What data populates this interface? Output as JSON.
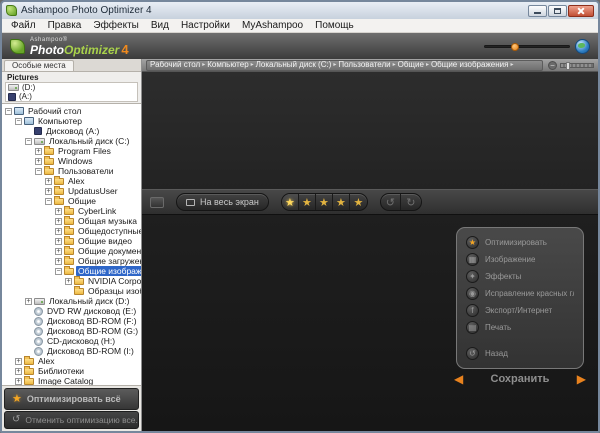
{
  "window": {
    "title": "Ashampoo Photo Optimizer 4"
  },
  "menubar": {
    "items": [
      "Файл",
      "Правка",
      "Эффекты",
      "Вид",
      "Настройки",
      "MyAshampoo",
      "Помощь"
    ]
  },
  "logo": {
    "brand_prefix": "Ashampoo®",
    "brand_white": "Photo",
    "brand_green": "Optimizer",
    "version": "4"
  },
  "breadcrumb": {
    "items": [
      "Рабочий стол",
      "Компьютер",
      "Локальный диск (C:)",
      "Пользователи",
      "Общие",
      "Общие изображения"
    ],
    "separator": "▸",
    "zoom_out_glyph": "−"
  },
  "sidebar": {
    "tab_label": "Особые места",
    "favorites_header": "Pictures",
    "favorites": [
      {
        "label": "(D:)",
        "icon": "drive"
      },
      {
        "label": "(A:)",
        "icon": "floppy"
      }
    ],
    "tree": [
      {
        "label": "Рабочий стол",
        "level": 0,
        "icon": "desktop",
        "exp": "minus"
      },
      {
        "label": "Компьютер",
        "level": 1,
        "icon": "computer",
        "exp": "minus"
      },
      {
        "label": "Дисковод (A:)",
        "level": 2,
        "icon": "floppy",
        "exp": "none"
      },
      {
        "label": "Локальный диск (C:)",
        "level": 2,
        "icon": "drive",
        "exp": "minus"
      },
      {
        "label": "Program Files",
        "level": 3,
        "icon": "folder",
        "exp": "plus"
      },
      {
        "label": "Windows",
        "level": 3,
        "icon": "folder",
        "exp": "plus"
      },
      {
        "label": "Пользователи",
        "level": 3,
        "icon": "folder",
        "exp": "minus"
      },
      {
        "label": "Alex",
        "level": 4,
        "icon": "folder",
        "exp": "plus"
      },
      {
        "label": "UpdatusUser",
        "level": 4,
        "icon": "folder",
        "exp": "plus"
      },
      {
        "label": "Общие",
        "level": 4,
        "icon": "folder",
        "exp": "minus"
      },
      {
        "label": "CyberLink",
        "level": 5,
        "icon": "folder",
        "exp": "plus"
      },
      {
        "label": "Общая музыка",
        "level": 5,
        "icon": "folder",
        "exp": "plus"
      },
      {
        "label": "Общедоступные ТВ",
        "level": 5,
        "icon": "folder",
        "exp": "plus"
      },
      {
        "label": "Общие видео",
        "level": 5,
        "icon": "folder",
        "exp": "plus"
      },
      {
        "label": "Общие документы",
        "level": 5,
        "icon": "folder",
        "exp": "plus"
      },
      {
        "label": "Общие загруженные",
        "level": 5,
        "icon": "folder",
        "exp": "plus"
      },
      {
        "label": "Общие изображения",
        "level": 5,
        "icon": "folder",
        "exp": "minus",
        "selected": true
      },
      {
        "label": "NVIDIA Corporation",
        "level": 6,
        "icon": "folder",
        "exp": "plus"
      },
      {
        "label": "Образцы изобра...",
        "level": 6,
        "icon": "folder",
        "exp": "none"
      },
      {
        "label": "Локальный диск (D:)",
        "level": 2,
        "icon": "drive",
        "exp": "plus"
      },
      {
        "label": "DVD RW дисковод (E:)",
        "level": 2,
        "icon": "cd",
        "exp": "none"
      },
      {
        "label": "Дисковод BD-ROM (F:)",
        "level": 2,
        "icon": "cd",
        "exp": "none"
      },
      {
        "label": "Дисковод BD-ROM (G:)",
        "level": 2,
        "icon": "cd",
        "exp": "none"
      },
      {
        "label": "CD-дисковод (H:)",
        "level": 2,
        "icon": "cd",
        "exp": "none"
      },
      {
        "label": "Дисковод BD-ROM (I:)",
        "level": 2,
        "icon": "cd",
        "exp": "none"
      },
      {
        "label": "Alex",
        "level": 1,
        "icon": "folder",
        "exp": "plus"
      },
      {
        "label": "Библиотеки",
        "level": 1,
        "icon": "folder",
        "exp": "plus"
      },
      {
        "label": "Image Catalog",
        "level": 1,
        "icon": "folder",
        "exp": "plus"
      }
    ],
    "optimize_all_label": "Оптимизировать всё",
    "optimize_star_glyph": "★",
    "undo_all_label": "Отменить оптимизацию все...",
    "undo_glyph": "↺"
  },
  "toolbar": {
    "fullscreen_label": "На весь экран",
    "star_count": 5,
    "star_glyph": "★",
    "rotate_left": "↺",
    "rotate_right": "↻"
  },
  "right_menu": {
    "items": [
      {
        "label": "Оптимизировать",
        "icon": "star",
        "glyph": "★",
        "accent": true
      },
      {
        "label": "Изображение",
        "icon": "image",
        "glyph": "▦"
      },
      {
        "label": "Эффекты",
        "icon": "effects",
        "glyph": "✦"
      },
      {
        "label": "Исправление красных глаз",
        "icon": "red-eye",
        "glyph": "◉"
      },
      {
        "label": "Экспорт/Интернет",
        "icon": "export",
        "glyph": "f"
      },
      {
        "label": "Печать",
        "icon": "print",
        "glyph": "▤"
      },
      {
        "label": "Назад",
        "icon": "back",
        "glyph": "↺",
        "gap": true
      }
    ]
  },
  "save_bar": {
    "label": "Сохранить",
    "prev": "◀",
    "next": "▶"
  },
  "colors": {
    "accent_orange": "#f08a1e",
    "star_gold": "#f2c94c",
    "logo_green": "#a9d24b",
    "selection_blue": "#2e66c8"
  }
}
